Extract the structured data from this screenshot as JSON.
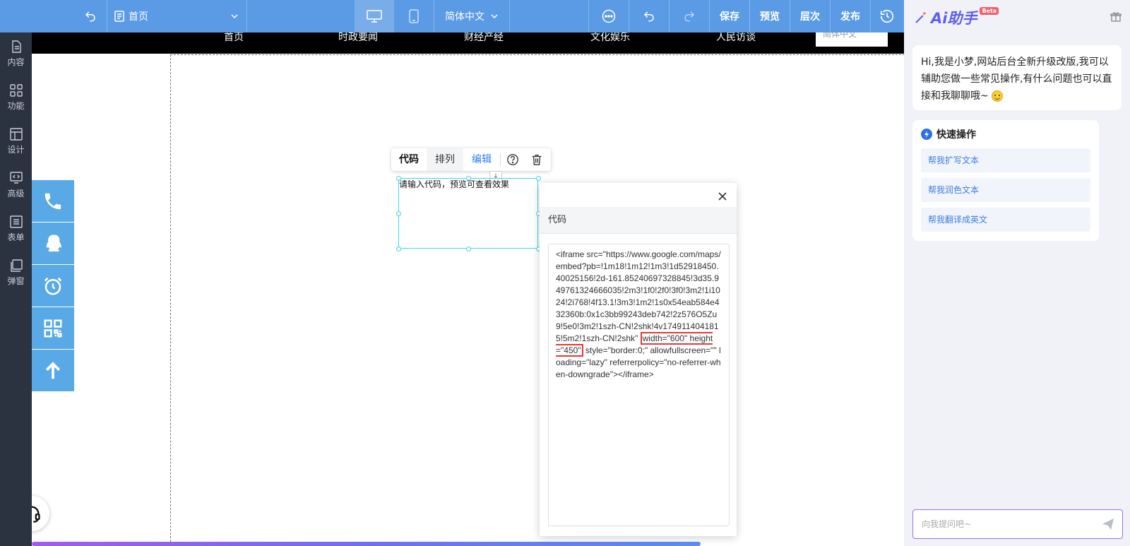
{
  "toolbar": {
    "page_name": "首页",
    "language": "简体中文",
    "save": "保存",
    "preview": "预览",
    "layers": "层次",
    "publish": "发布"
  },
  "sidebar": {
    "items": [
      {
        "label": "内容",
        "icon": "file-icon"
      },
      {
        "label": "功能",
        "icon": "grid-icon"
      },
      {
        "label": "设计",
        "icon": "layout-icon"
      },
      {
        "label": "高级",
        "icon": "code-monitor-icon"
      },
      {
        "label": "表单",
        "icon": "list-icon"
      },
      {
        "label": "弹窗",
        "icon": "popup-icon"
      }
    ]
  },
  "site_nav": {
    "items": [
      "首页",
      "时政要闻",
      "财经产经",
      "文化娱乐",
      "人民访谈"
    ],
    "language": "简体中文"
  },
  "element_toolbar": {
    "tab_code": "代码",
    "tab_arrange": "排列",
    "tab_edit": "编辑"
  },
  "element": {
    "placeholder": "请输入代码，预览可查看效果"
  },
  "code_dialog": {
    "title": "代码",
    "code_before": "<iframe src=\"https://www.google.com/maps/embed?pb=!1m18!1m12!1m3!1d52918450.40025156!2d-161.85240697328845!3d35.949761324666035!2m3!1f0!2f0!3f0!3m2!1i1024!2i768!4f13.1!3m3!1m2!1s0x54eab584e432360b:0x1c3bb99243deb742!2z576O5Zu9!5e0!3m2!1szh-CN!2shk!4v1749114041815!5m2!1szh-CN!2shk\" ",
    "code_highlight": "width=\"600\" height=\"450\"",
    "code_after": " style=\"border:0;\" allowfullscreen=\"\" loading=\"lazy\" referrerpolicy=\"no-referrer-when-downgrade\"></iframe>"
  },
  "ai_panel": {
    "logo_text": "Ai助手",
    "beta": "Beta",
    "greeting": "Hi,我是小梦,网站后台全新升级改版,我可以辅助您做一些常见操作,有什么问题也可以直接和我聊聊哦~",
    "quick_title": "快速操作",
    "quick_actions": [
      "帮我扩写文本",
      "帮我润色文本",
      "帮我翻译成英文"
    ],
    "input_placeholder": "向我提问吧~"
  },
  "colors": {
    "topbar": "#5b9be6",
    "sidebar": "#2b3240",
    "float_buttons": "#58a9e6",
    "accent_purple": "#5d5ff0",
    "highlight_red": "#e53935"
  }
}
